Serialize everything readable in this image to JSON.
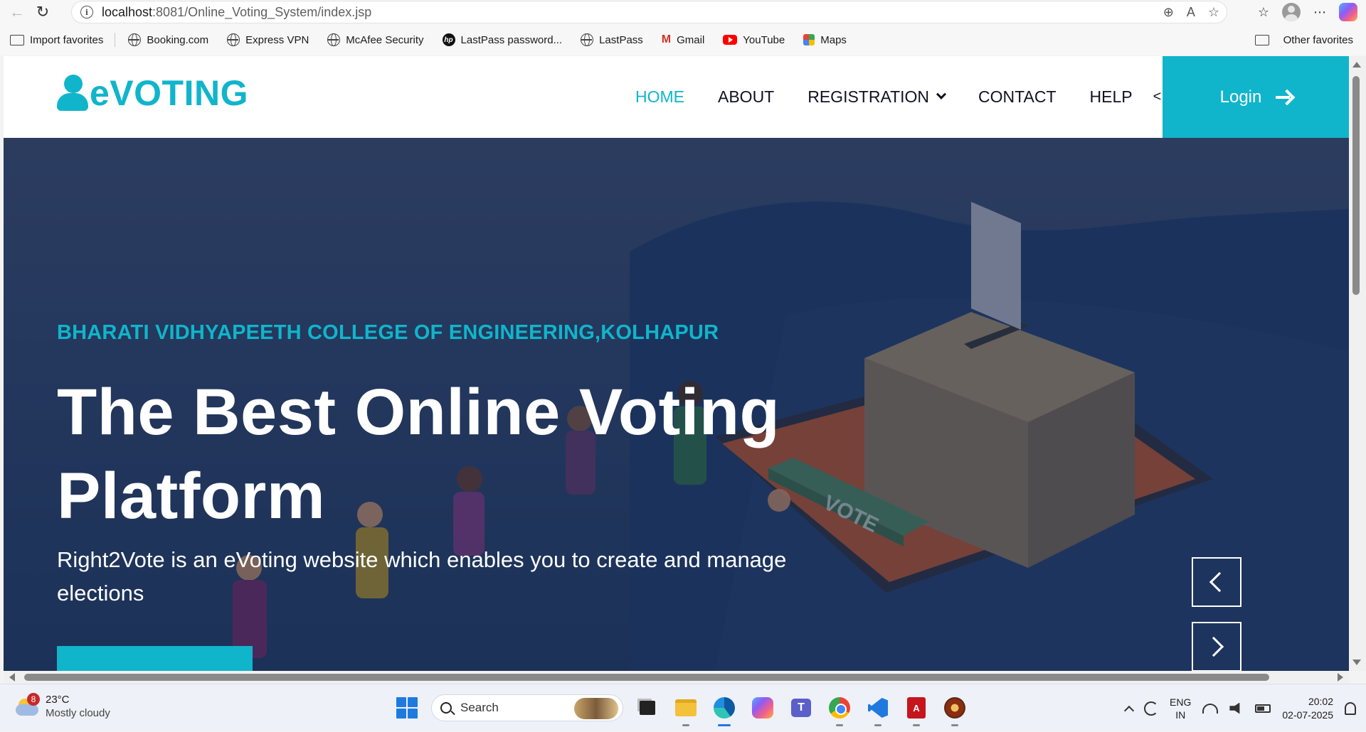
{
  "browser": {
    "url_host": "localhost",
    "url_path": ":8081/Online_Voting_System/index.jsp",
    "favorites": [
      {
        "label": "Import favorites",
        "icon": "folder-icon"
      },
      {
        "label": "Booking.com",
        "icon": "globe-icon"
      },
      {
        "label": "Express VPN",
        "icon": "globe-icon"
      },
      {
        "label": "McAfee Security",
        "icon": "globe-icon"
      },
      {
        "label": "LastPass password...",
        "icon": "hp-icon"
      },
      {
        "label": "LastPass",
        "icon": "globe-icon"
      },
      {
        "label": "Gmail",
        "icon": "gmail-icon"
      },
      {
        "label": "YouTube",
        "icon": "youtube-icon"
      },
      {
        "label": "Maps",
        "icon": "maps-icon"
      }
    ],
    "other_favorites": "Other favorites"
  },
  "site": {
    "brand": "eVOTING",
    "accent_color": "#10b5cb",
    "nav": {
      "home": "HOME",
      "about": "ABOUT",
      "registration": "REGISTRATION",
      "contact": "CONTACT",
      "help": "HELP",
      "overflow": "<"
    },
    "login_label": "Login",
    "hero": {
      "subtitle": "BHARATI VIDHYAPEETH COLLEGE OF ENGINEERING,KOLHAPUR",
      "title": "The Best Online Voting Platform",
      "description": "Right2Vote is an eVoting website which enables you to create and manage elections",
      "ballot_text": "VOTE"
    }
  },
  "taskbar": {
    "weather_temp": "23°C",
    "weather_cond": "Mostly cloudy",
    "weather_badge": "8",
    "search_placeholder": "Search",
    "lang_top": "ENG",
    "lang_bottom": "IN",
    "time": "20:02",
    "date": "02-07-2025"
  }
}
